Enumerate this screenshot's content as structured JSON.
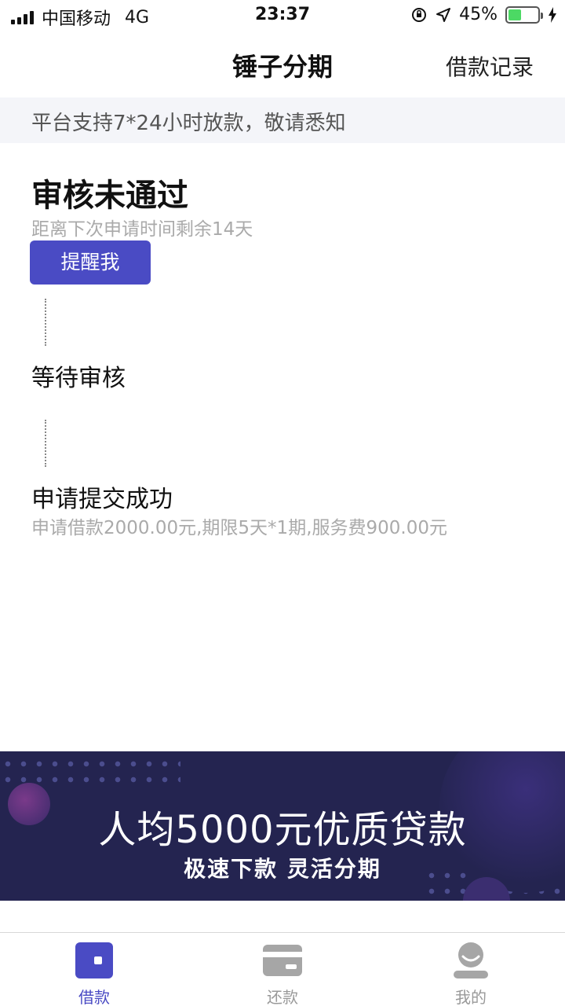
{
  "status_bar": {
    "carrier": "中国移动",
    "network": "4G",
    "time": "23:37",
    "battery": "45%"
  },
  "nav": {
    "title": "锤子分期",
    "right_link": "借款记录"
  },
  "notice": {
    "text": "平台支持7*24小时放款，敬请悉知"
  },
  "timeline": {
    "step1": {
      "title": "审核未通过",
      "subtitle": "距离下次申请时间剩余14天",
      "button": "提醒我"
    },
    "step2": {
      "title": "等待审核"
    },
    "step3": {
      "title": "申请提交成功",
      "subtitle": "申请借款2000.00元,期限5天*1期,服务费900.00元"
    }
  },
  "banner": {
    "title": "人均5000元优质贷款",
    "subtitle": "极速下款 灵活分期"
  },
  "tabs": [
    {
      "label": "借款",
      "icon": "wallet-icon",
      "active": true
    },
    {
      "label": "还款",
      "icon": "card-icon",
      "active": false
    },
    {
      "label": "我的",
      "icon": "user-icon",
      "active": false
    }
  ],
  "colors": {
    "accent": "#4a4bc4",
    "banner_bg": "#242450",
    "battery_green": "#4cd964"
  }
}
